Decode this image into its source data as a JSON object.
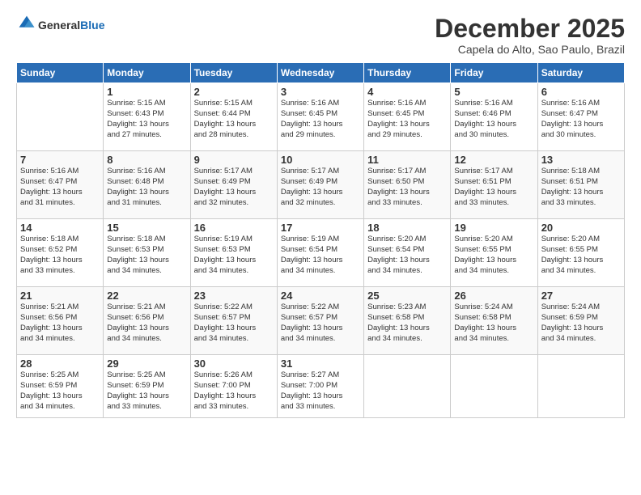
{
  "logo": {
    "line1": "General",
    "line2": "Blue"
  },
  "title": "December 2025",
  "location": "Capela do Alto, Sao Paulo, Brazil",
  "days_of_week": [
    "Sunday",
    "Monday",
    "Tuesday",
    "Wednesday",
    "Thursday",
    "Friday",
    "Saturday"
  ],
  "weeks": [
    [
      {
        "num": "",
        "info": ""
      },
      {
        "num": "1",
        "info": "Sunrise: 5:15 AM\nSunset: 6:43 PM\nDaylight: 13 hours\nand 27 minutes."
      },
      {
        "num": "2",
        "info": "Sunrise: 5:15 AM\nSunset: 6:44 PM\nDaylight: 13 hours\nand 28 minutes."
      },
      {
        "num": "3",
        "info": "Sunrise: 5:16 AM\nSunset: 6:45 PM\nDaylight: 13 hours\nand 29 minutes."
      },
      {
        "num": "4",
        "info": "Sunrise: 5:16 AM\nSunset: 6:45 PM\nDaylight: 13 hours\nand 29 minutes."
      },
      {
        "num": "5",
        "info": "Sunrise: 5:16 AM\nSunset: 6:46 PM\nDaylight: 13 hours\nand 30 minutes."
      },
      {
        "num": "6",
        "info": "Sunrise: 5:16 AM\nSunset: 6:47 PM\nDaylight: 13 hours\nand 30 minutes."
      }
    ],
    [
      {
        "num": "7",
        "info": "Sunrise: 5:16 AM\nSunset: 6:47 PM\nDaylight: 13 hours\nand 31 minutes."
      },
      {
        "num": "8",
        "info": "Sunrise: 5:16 AM\nSunset: 6:48 PM\nDaylight: 13 hours\nand 31 minutes."
      },
      {
        "num": "9",
        "info": "Sunrise: 5:17 AM\nSunset: 6:49 PM\nDaylight: 13 hours\nand 32 minutes."
      },
      {
        "num": "10",
        "info": "Sunrise: 5:17 AM\nSunset: 6:49 PM\nDaylight: 13 hours\nand 32 minutes."
      },
      {
        "num": "11",
        "info": "Sunrise: 5:17 AM\nSunset: 6:50 PM\nDaylight: 13 hours\nand 33 minutes."
      },
      {
        "num": "12",
        "info": "Sunrise: 5:17 AM\nSunset: 6:51 PM\nDaylight: 13 hours\nand 33 minutes."
      },
      {
        "num": "13",
        "info": "Sunrise: 5:18 AM\nSunset: 6:51 PM\nDaylight: 13 hours\nand 33 minutes."
      }
    ],
    [
      {
        "num": "14",
        "info": "Sunrise: 5:18 AM\nSunset: 6:52 PM\nDaylight: 13 hours\nand 33 minutes."
      },
      {
        "num": "15",
        "info": "Sunrise: 5:18 AM\nSunset: 6:53 PM\nDaylight: 13 hours\nand 34 minutes."
      },
      {
        "num": "16",
        "info": "Sunrise: 5:19 AM\nSunset: 6:53 PM\nDaylight: 13 hours\nand 34 minutes."
      },
      {
        "num": "17",
        "info": "Sunrise: 5:19 AM\nSunset: 6:54 PM\nDaylight: 13 hours\nand 34 minutes."
      },
      {
        "num": "18",
        "info": "Sunrise: 5:20 AM\nSunset: 6:54 PM\nDaylight: 13 hours\nand 34 minutes."
      },
      {
        "num": "19",
        "info": "Sunrise: 5:20 AM\nSunset: 6:55 PM\nDaylight: 13 hours\nand 34 minutes."
      },
      {
        "num": "20",
        "info": "Sunrise: 5:20 AM\nSunset: 6:55 PM\nDaylight: 13 hours\nand 34 minutes."
      }
    ],
    [
      {
        "num": "21",
        "info": "Sunrise: 5:21 AM\nSunset: 6:56 PM\nDaylight: 13 hours\nand 34 minutes."
      },
      {
        "num": "22",
        "info": "Sunrise: 5:21 AM\nSunset: 6:56 PM\nDaylight: 13 hours\nand 34 minutes."
      },
      {
        "num": "23",
        "info": "Sunrise: 5:22 AM\nSunset: 6:57 PM\nDaylight: 13 hours\nand 34 minutes."
      },
      {
        "num": "24",
        "info": "Sunrise: 5:22 AM\nSunset: 6:57 PM\nDaylight: 13 hours\nand 34 minutes."
      },
      {
        "num": "25",
        "info": "Sunrise: 5:23 AM\nSunset: 6:58 PM\nDaylight: 13 hours\nand 34 minutes."
      },
      {
        "num": "26",
        "info": "Sunrise: 5:24 AM\nSunset: 6:58 PM\nDaylight: 13 hours\nand 34 minutes."
      },
      {
        "num": "27",
        "info": "Sunrise: 5:24 AM\nSunset: 6:59 PM\nDaylight: 13 hours\nand 34 minutes."
      }
    ],
    [
      {
        "num": "28",
        "info": "Sunrise: 5:25 AM\nSunset: 6:59 PM\nDaylight: 13 hours\nand 34 minutes."
      },
      {
        "num": "29",
        "info": "Sunrise: 5:25 AM\nSunset: 6:59 PM\nDaylight: 13 hours\nand 33 minutes."
      },
      {
        "num": "30",
        "info": "Sunrise: 5:26 AM\nSunset: 7:00 PM\nDaylight: 13 hours\nand 33 minutes."
      },
      {
        "num": "31",
        "info": "Sunrise: 5:27 AM\nSunset: 7:00 PM\nDaylight: 13 hours\nand 33 minutes."
      },
      {
        "num": "",
        "info": ""
      },
      {
        "num": "",
        "info": ""
      },
      {
        "num": "",
        "info": ""
      }
    ]
  ]
}
